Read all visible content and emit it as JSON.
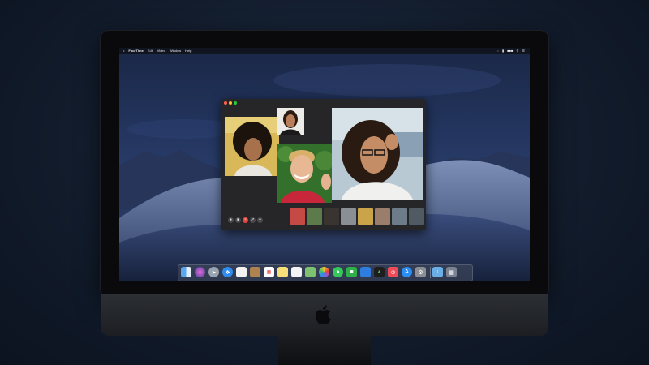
{
  "menubar": {
    "app_name": "FaceTime",
    "items": [
      "Edit",
      "Video",
      "Window",
      "Help"
    ]
  },
  "facetime": {
    "window_title": "",
    "controls": [
      "mic-icon",
      "camera-icon",
      "end-call-icon",
      "fullscreen-icon",
      "effects-icon"
    ],
    "accent_end_call": "#e8413a"
  },
  "dock": {
    "apps": [
      "Finder",
      "Siri",
      "Launchpad",
      "Safari",
      "Photos Browser",
      "Contacts",
      "Calendar",
      "Notes",
      "Reminders",
      "Maps",
      "Photos",
      "Messages",
      "FaceTime",
      "Keynote",
      "Stocks",
      "News",
      "App Store",
      "System Preferences",
      "Downloads",
      "Trash"
    ]
  },
  "imac": {
    "logo": "apple-logo"
  }
}
